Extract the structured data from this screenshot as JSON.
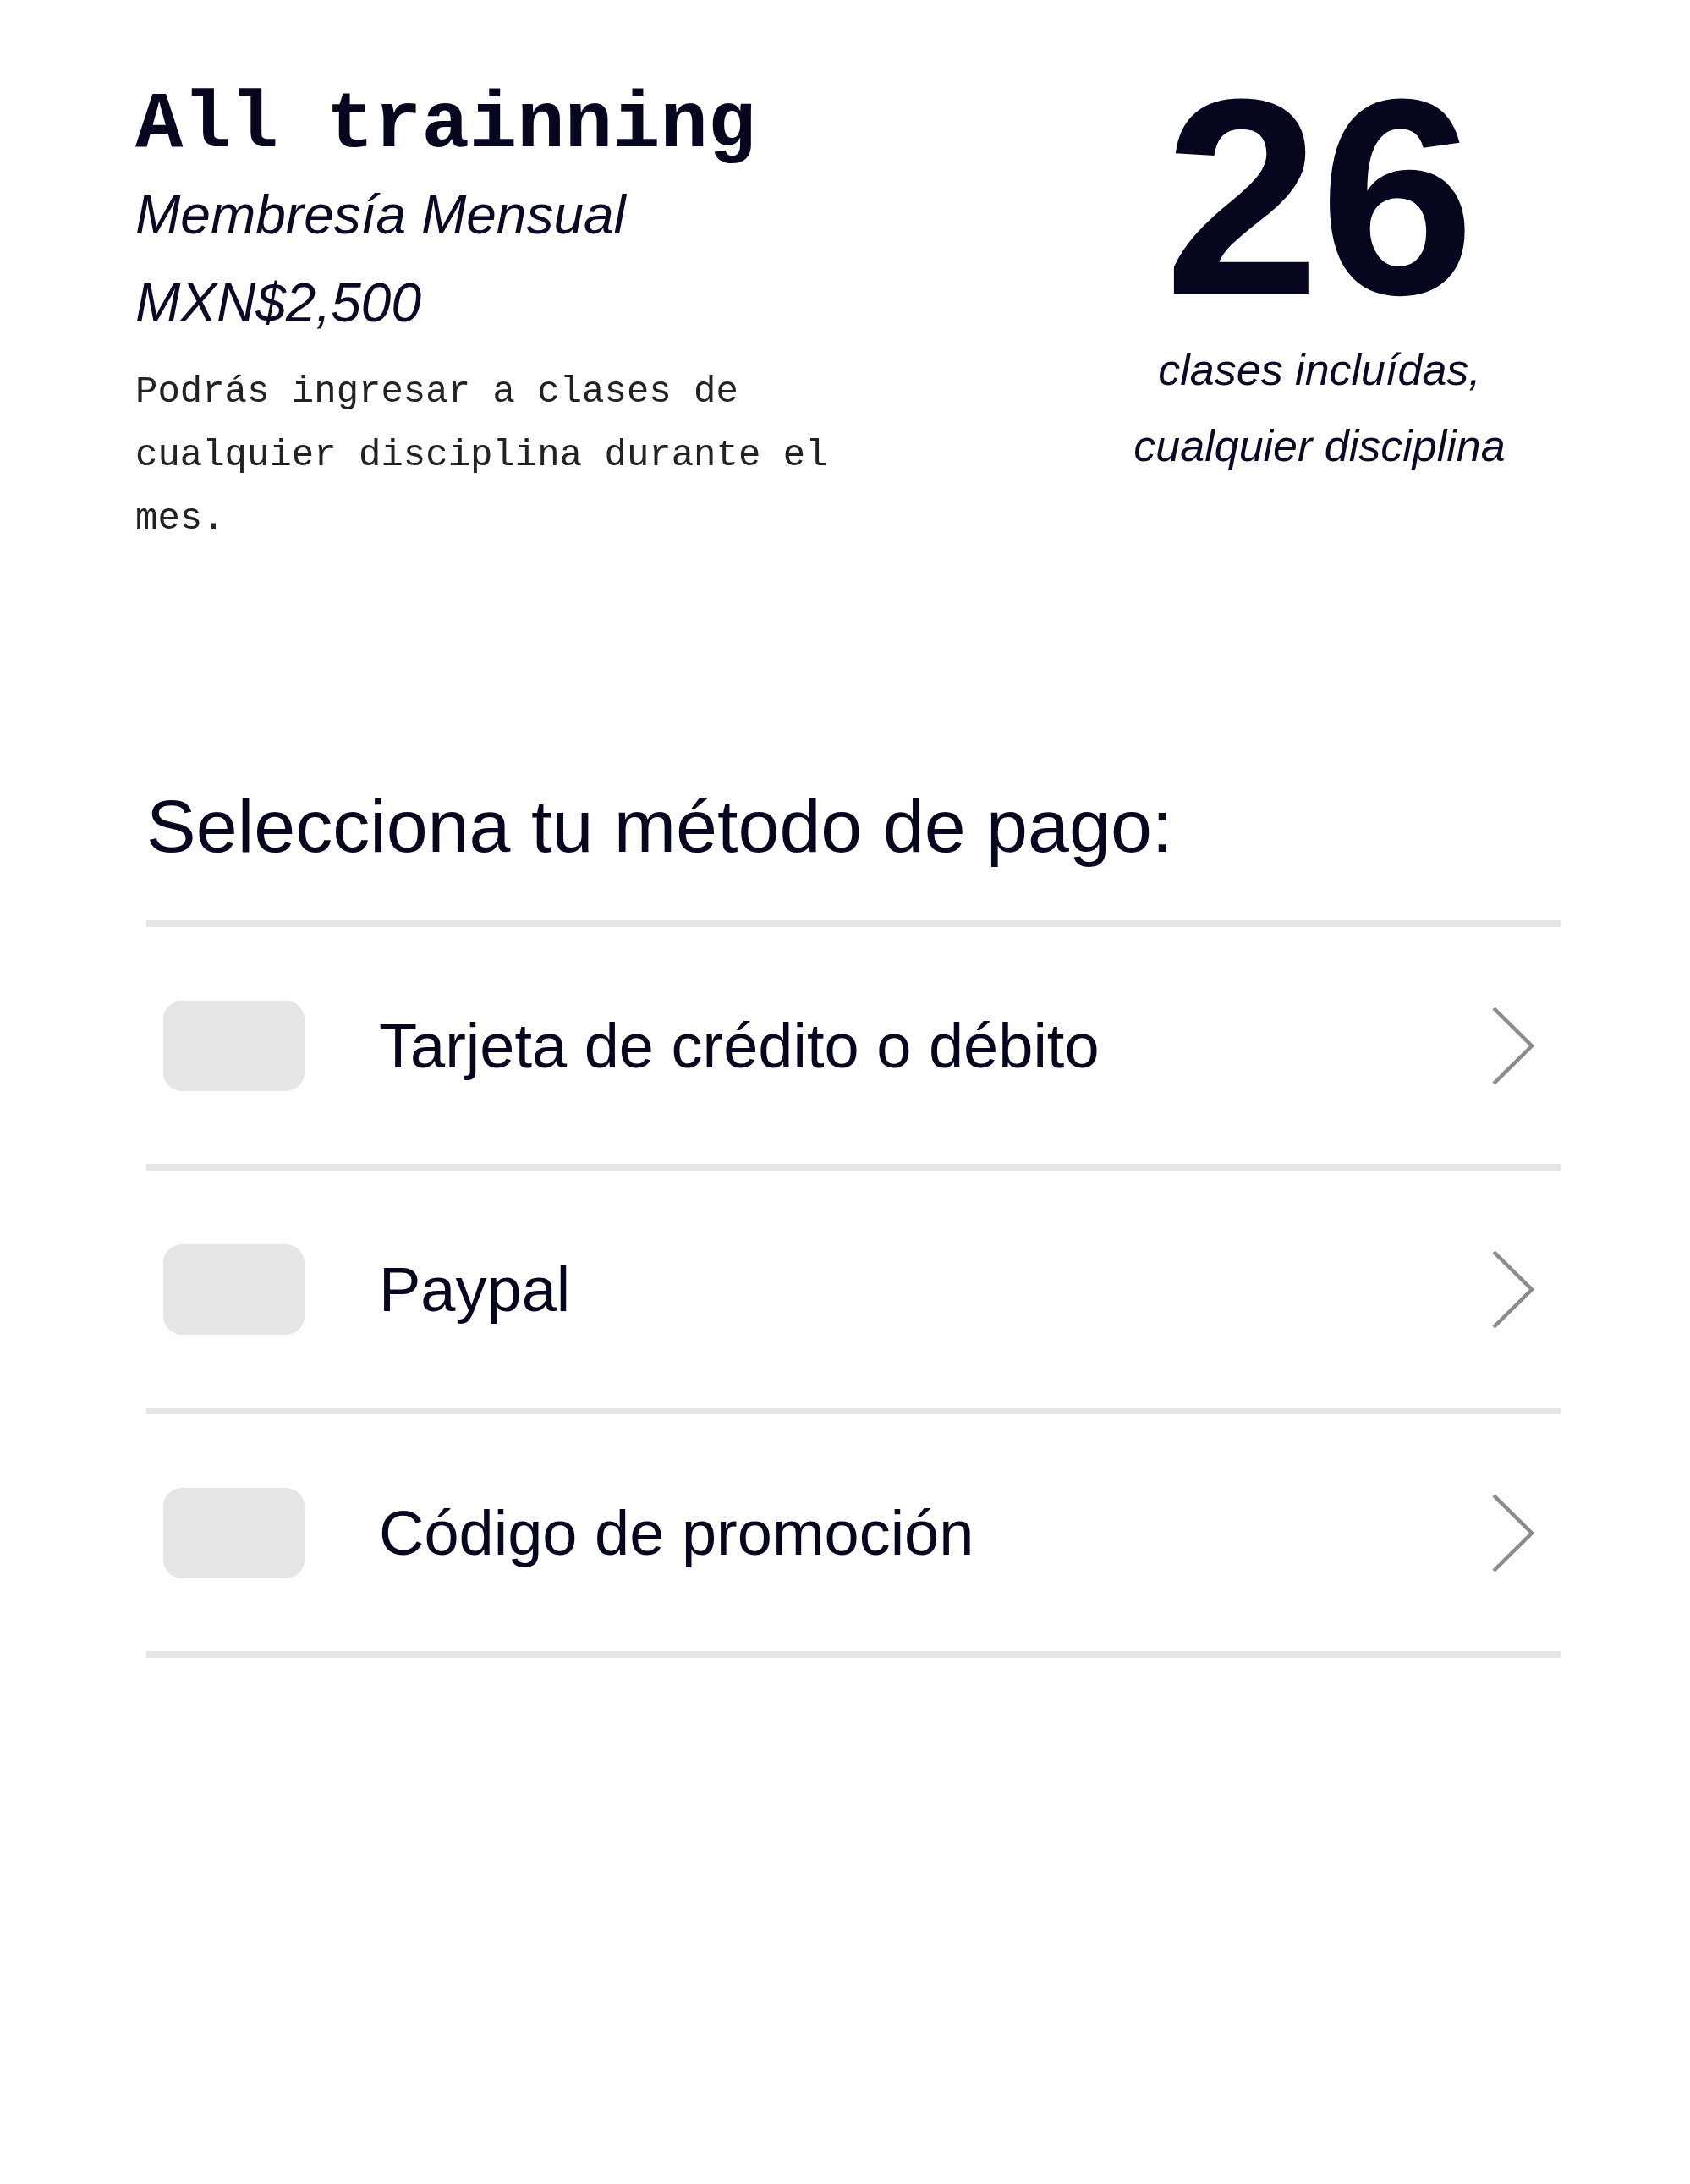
{
  "plan": {
    "title": "All trainning",
    "subtitle": "Membresía Mensual",
    "price": "MXN$2,500",
    "description": "Podrás ingresar a clases de cualquier disciplina durante el mes."
  },
  "classes": {
    "count": "26",
    "caption": "clases incluídas, cualquier disciplina"
  },
  "payment": {
    "heading": "Selecciona tu método de pago:",
    "options": [
      {
        "label": "Tarjeta de crédito o débito"
      },
      {
        "label": "Paypal"
      },
      {
        "label": "Código de promoción"
      }
    ]
  }
}
